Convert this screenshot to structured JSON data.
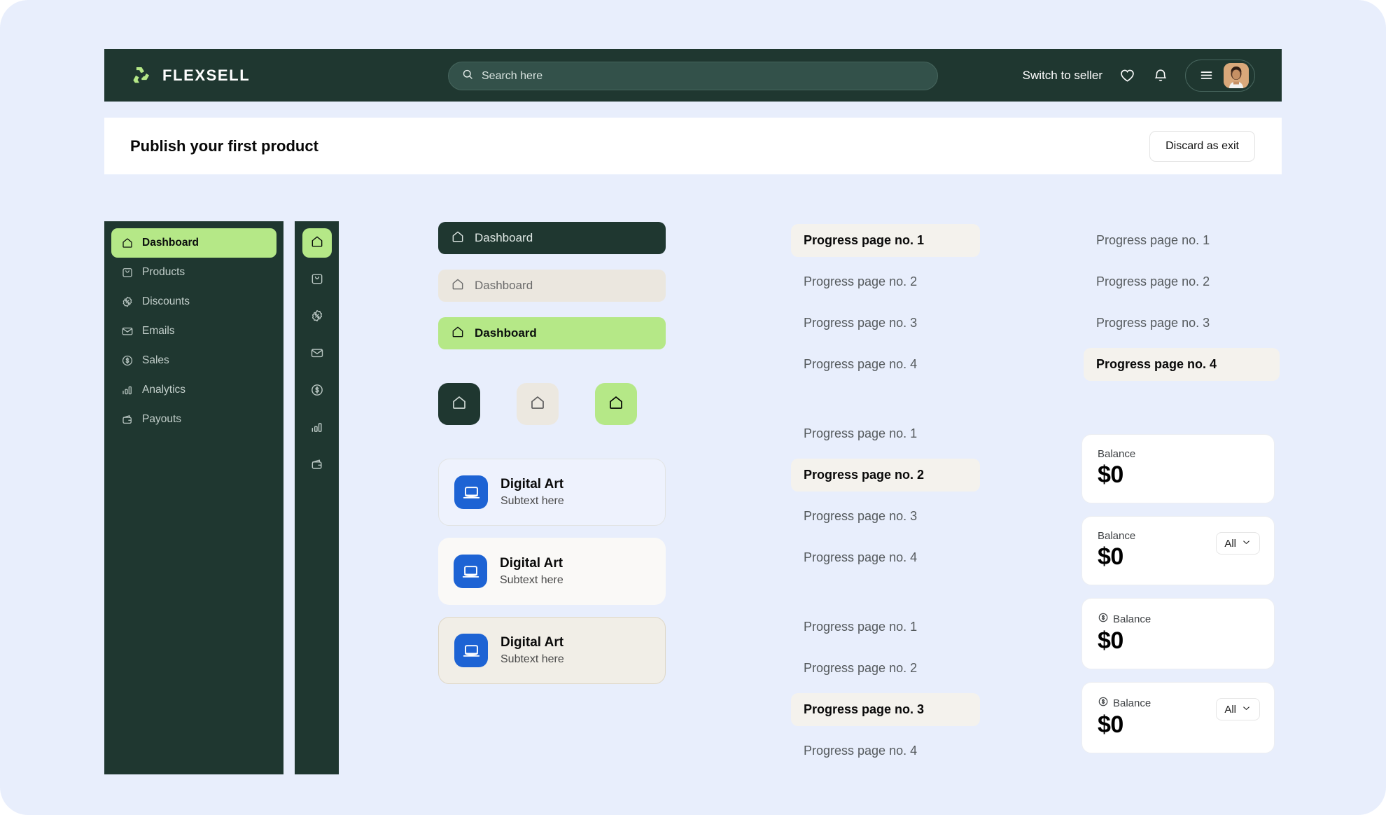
{
  "brand": {
    "name": "FLEXSELL",
    "logo_icon": "recycle-logo-icon"
  },
  "header": {
    "search": {
      "placeholder": "Search here",
      "value": "",
      "icon": "search-icon"
    },
    "switch_label": "Switch to seller",
    "wishlist_icon": "heart-icon",
    "notifications_icon": "bell-icon",
    "menu_icon": "hamburger-menu-icon",
    "avatar_icon": "user-avatar"
  },
  "subheader": {
    "title": "Publish your first product",
    "discard_label": "Discard as exit"
  },
  "sidebar": {
    "items": [
      {
        "label": "Dashboard",
        "icon": "home-icon",
        "active": true
      },
      {
        "label": "Products",
        "icon": "bag-icon",
        "active": false
      },
      {
        "label": "Discounts",
        "icon": "discount-icon",
        "active": false
      },
      {
        "label": "Emails",
        "icon": "envelope-icon",
        "active": false
      },
      {
        "label": "Sales",
        "icon": "dollar-circle-icon",
        "active": false
      },
      {
        "label": "Analytics",
        "icon": "bar-chart-icon",
        "active": false
      },
      {
        "label": "Payouts",
        "icon": "wallet-icon",
        "active": false
      }
    ]
  },
  "rail": {
    "items": [
      {
        "icon": "home-icon",
        "active": true
      },
      {
        "icon": "bag-icon",
        "active": false
      },
      {
        "icon": "discount-icon",
        "active": false
      },
      {
        "icon": "envelope-icon",
        "active": false
      },
      {
        "icon": "dollar-circle-icon",
        "active": false
      },
      {
        "icon": "bar-chart-icon",
        "active": false
      },
      {
        "icon": "wallet-icon",
        "active": false
      }
    ]
  },
  "dashboard_buttons": [
    {
      "label": "Dashboard",
      "icon": "home-icon",
      "variant": "dark"
    },
    {
      "label": "Dashboard",
      "icon": "home-icon",
      "variant": "beige"
    },
    {
      "label": "Dashboard",
      "icon": "home-icon",
      "variant": "green"
    }
  ],
  "icon_squares": [
    {
      "icon": "home-icon",
      "variant": "dark"
    },
    {
      "icon": "home-icon",
      "variant": "beige"
    },
    {
      "icon": "home-icon",
      "variant": "green"
    }
  ],
  "product_cards": [
    {
      "title": "Digital Art",
      "subtext": "Subtext here",
      "icon": "laptop-icon",
      "variant": "a"
    },
    {
      "title": "Digital Art",
      "subtext": "Subtext here",
      "icon": "laptop-icon",
      "variant": "b"
    },
    {
      "title": "Digital Art",
      "subtext": "Subtext here",
      "icon": "laptop-icon",
      "variant": "c"
    }
  ],
  "progress_groups": [
    {
      "selected_index": 0,
      "items": [
        "Progress page no. 1",
        "Progress page no. 2",
        "Progress page no. 3",
        "Progress page no. 4"
      ]
    },
    {
      "selected_index": 1,
      "items": [
        "Progress page no. 1",
        "Progress page no. 2",
        "Progress page no. 3",
        "Progress page no. 4"
      ]
    },
    {
      "selected_index": 2,
      "items": [
        "Progress page no. 1",
        "Progress page no. 2",
        "Progress page no. 3",
        "Progress page no. 4"
      ]
    },
    {
      "selected_index": 3,
      "items": [
        "Progress page no. 1",
        "Progress page no. 2",
        "Progress page no. 3",
        "Progress page no. 4"
      ]
    }
  ],
  "balance_cards": [
    {
      "label": "Balance",
      "value": "$0",
      "has_icon": false,
      "has_select": false,
      "select_label": ""
    },
    {
      "label": "Balance",
      "value": "$0",
      "has_icon": false,
      "has_select": true,
      "select_label": "All"
    },
    {
      "label": "Balance",
      "value": "$0",
      "has_icon": true,
      "has_select": false,
      "select_label": ""
    },
    {
      "label": "Balance",
      "value": "$0",
      "has_icon": true,
      "has_select": true,
      "select_label": "All"
    }
  ],
  "colors": {
    "page_background": "#e8eefc",
    "brand_dark": "#1f3730",
    "accent_green": "#b5e887",
    "beige": "#ebe7df",
    "selected_row": "#f4f2ed",
    "icon_blue": "#1d63d4"
  }
}
